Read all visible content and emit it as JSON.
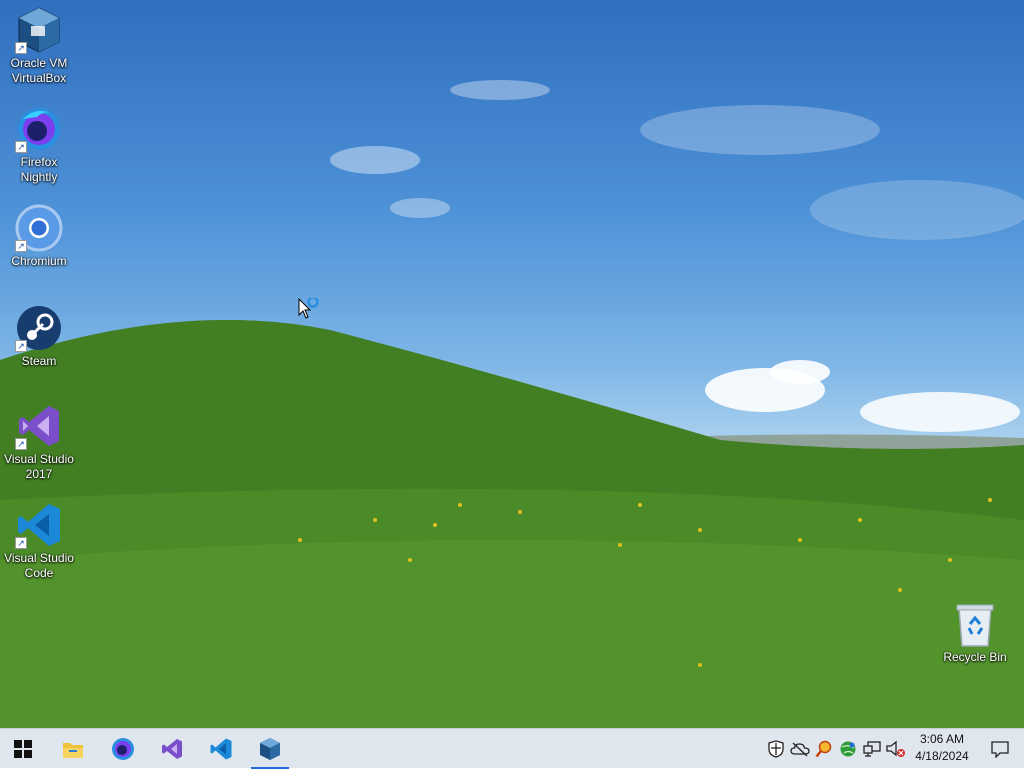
{
  "desktop": {
    "icons": [
      {
        "label": "Oracle VM\nVirtualBox",
        "icon": "virtualbox-icon"
      },
      {
        "label": "Firefox\nNightly",
        "icon": "firefox-nightly-icon"
      },
      {
        "label": "Chromium",
        "icon": "chromium-icon"
      },
      {
        "label": "Steam",
        "icon": "steam-icon"
      },
      {
        "label": "Visual Studio\n2017",
        "icon": "visual-studio-icon"
      },
      {
        "label": "Visual Studio\nCode",
        "icon": "vscode-icon"
      }
    ],
    "recycle_bin": {
      "label": "Recycle Bin",
      "icon": "recycle-bin-icon"
    }
  },
  "taskbar": {
    "start": "windows-start-icon",
    "pinned": [
      "file-explorer-icon",
      "firefox-icon",
      "visual-studio-icon",
      "vscode-icon",
      "virtualbox-icon"
    ],
    "active_app": "virtualbox",
    "tray_icons": [
      "security-shield-icon",
      "cloud-offline-icon",
      "search-magnifier-icon",
      "network-globe-icon",
      "network-monitor-icon",
      "volume-muted-icon"
    ],
    "clock": {
      "time": "3:06 AM",
      "date": "4/18/2024"
    },
    "notification": "action-center-icon"
  },
  "colors": {
    "accent": "#1f6fd6",
    "taskbar_bg": "#dfe6ee",
    "grass": "#4f8f2a",
    "sky": "#4f93d8"
  }
}
